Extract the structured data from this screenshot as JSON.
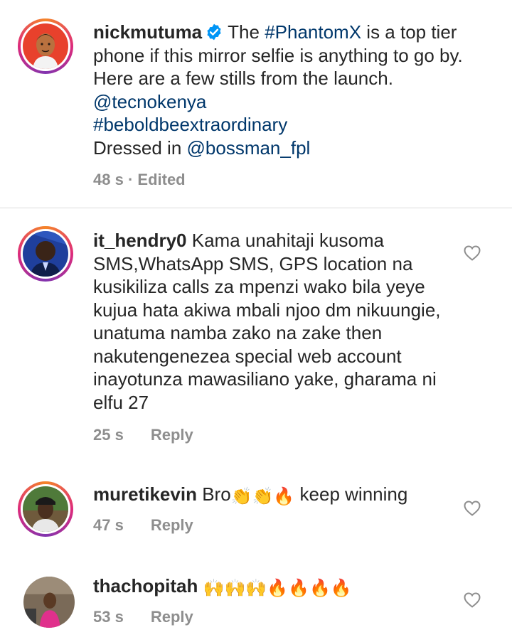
{
  "caption": {
    "username": "nickmutuma",
    "text_1": "The ",
    "hashtag_1": "#PhantomX",
    "text_2": " is a top tier phone if this mirror selfie is anything to go by. Here are a few stills from the launch. ",
    "mention_1": "@tecnokenya",
    "hashtag_2": "#beboldbeextraordinary",
    "text_3": "Dressed in ",
    "mention_2": "@bossman_fpl",
    "time": "48 s",
    "edited": "· Edited"
  },
  "comments": [
    {
      "username": "it_hendry0",
      "text": "Kama unahitaji kusoma SMS,WhatsApp SMS, GPS location na kusikiliza calls za mpenzi wako bila yeye kujua hata akiwa mbali njoo dm nikuungie, unatuma namba zako na zake then nakutengenezea special web account inayotunza mawasiliano yake, gharama ni elfu 27",
      "time": "25 s",
      "reply": "Reply"
    },
    {
      "username": "muretikevin",
      "text_before": "Bro",
      "emoji": "👏👏🔥",
      "text_after": " keep winning",
      "time": "47 s",
      "reply": "Reply"
    },
    {
      "username": "thachopitah",
      "emoji": "🙌🙌🙌🔥🔥🔥🔥",
      "time": "53 s",
      "reply": "Reply"
    }
  ],
  "colors": {
    "link": "#00376b",
    "meta": "#8e8e8e",
    "text": "#262626",
    "verified": "#0095f6"
  },
  "icons": [
    "verified-badge-icon",
    "heart-icon"
  ]
}
